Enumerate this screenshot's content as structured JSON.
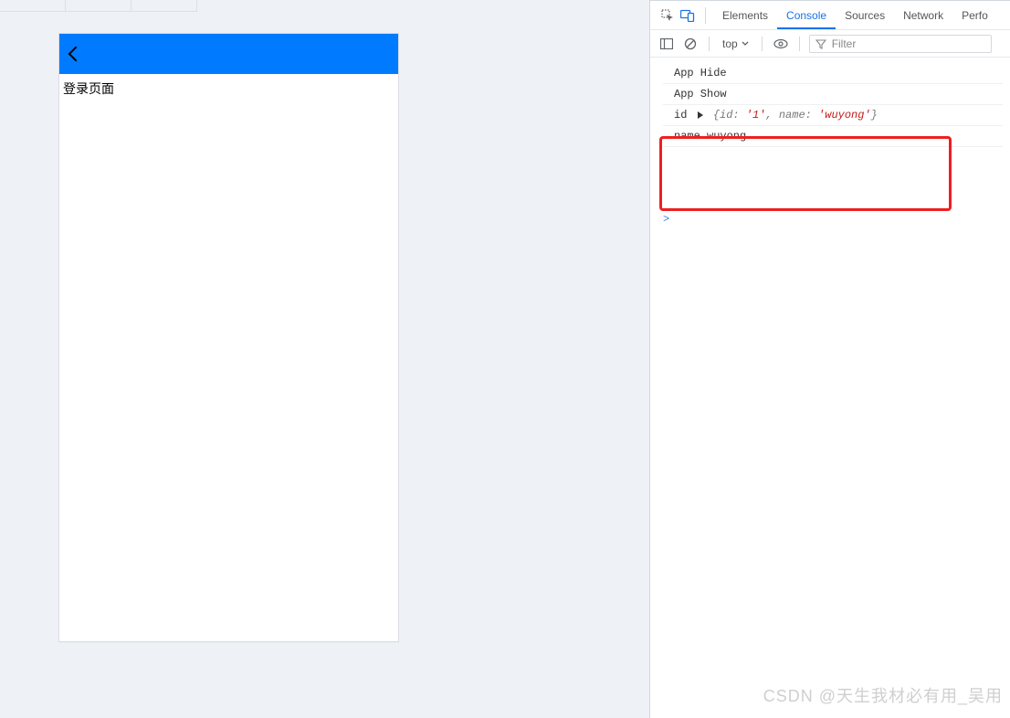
{
  "phone": {
    "page_title": "登录页面"
  },
  "devtools": {
    "tabs": {
      "elements": "Elements",
      "console": "Console",
      "sources": "Sources",
      "network": "Network",
      "performance": "Perfo"
    },
    "context": "top",
    "filter_placeholder": "Filter",
    "logs": [
      {
        "text": "App Hide"
      },
      {
        "text": "App Show"
      },
      {
        "label": "id",
        "type": "obj",
        "preview_plain": "{id: '1', name: 'wuyong'}"
      },
      {
        "text": "name wuyong"
      }
    ]
  },
  "watermark": "CSDN @天生我材必有用_吴用"
}
